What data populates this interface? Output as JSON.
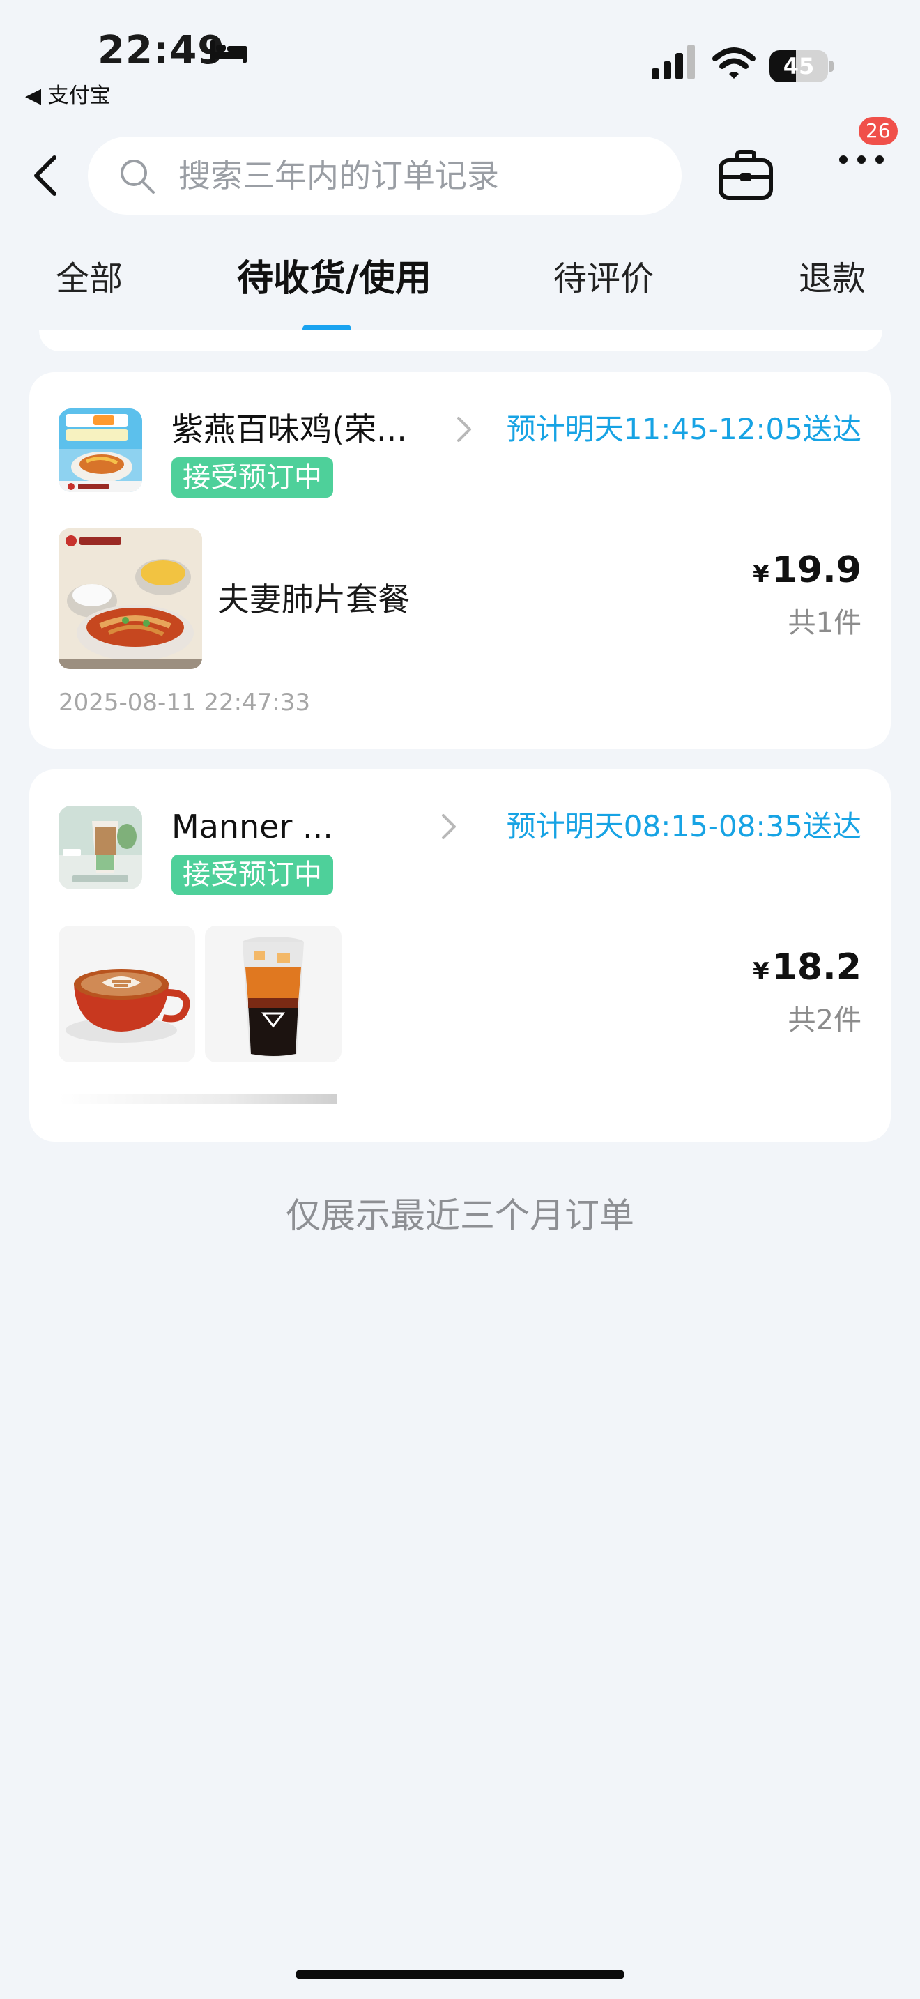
{
  "status_bar": {
    "time": "22:49",
    "back_app": "◀ 支付宝",
    "battery_level": 45,
    "battery_text": "45"
  },
  "nav": {
    "search_placeholder": "搜索三年内的订单记录",
    "more_badge": "26"
  },
  "tabs": [
    {
      "label": "全部",
      "active": false
    },
    {
      "label": "待收货/使用",
      "active": true
    },
    {
      "label": "待评价",
      "active": false
    },
    {
      "label": "退款",
      "active": false
    }
  ],
  "orders": [
    {
      "shop_name": "紫燕百味鸡(荣...",
      "eta": "预计明天11:45-12:05送达",
      "status": "接受预订中",
      "item_name": "夫妻肺片套餐",
      "currency": "¥",
      "price": "19.9",
      "quantity": "共1件",
      "order_time": "2025-08-11 22:47:33"
    },
    {
      "shop_name": "Manner ...",
      "eta": "预计明天08:15-08:35送达",
      "status": "接受预订中",
      "currency": "¥",
      "price": "18.2",
      "quantity": "共2件"
    }
  ],
  "footer_note": "仅展示最近三个月订单",
  "colors": {
    "accent_blue": "#1aa3f0",
    "eta_blue": "#17a3e4",
    "status_green": "#4ed09a",
    "badge_red": "#f0504a",
    "page_bg": "#f2f5f9"
  },
  "icons": [
    "bed-icon",
    "signal-icon",
    "wifi-icon",
    "battery-icon",
    "back-arrow-icon",
    "search-icon",
    "toolbox-icon",
    "more-icon",
    "chevron-right-icon"
  ]
}
